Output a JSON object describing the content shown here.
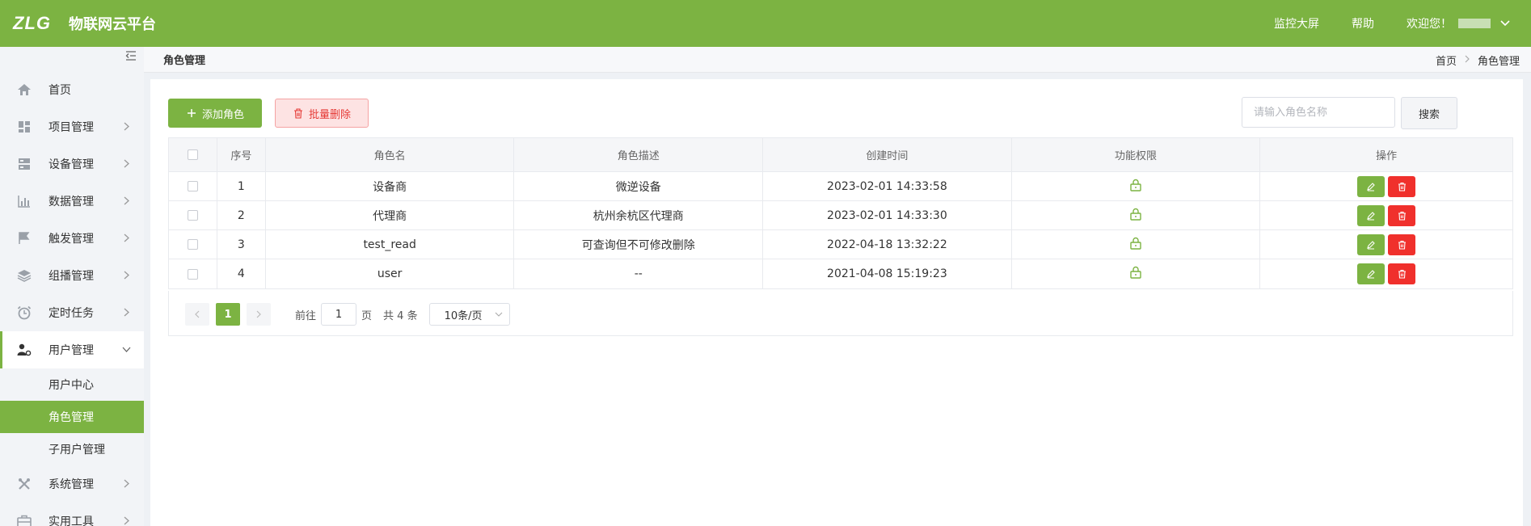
{
  "header": {
    "logo": "ZLG",
    "brand": "物联网云平台",
    "monitor_link": "监控大屏",
    "help_link": "帮助",
    "welcome": "欢迎您！",
    "bg_color": "#7cb342"
  },
  "breadcrumb": {
    "page_title": "角色管理",
    "home": "首页",
    "current": "角色管理"
  },
  "sidebar": {
    "items": [
      {
        "label": "首页",
        "icon": "home-icon",
        "has_arrow": false
      },
      {
        "label": "项目管理",
        "icon": "dashboard-icon",
        "has_arrow": true
      },
      {
        "label": "设备管理",
        "icon": "device-icon",
        "has_arrow": true
      },
      {
        "label": "数据管理",
        "icon": "bar-chart-icon",
        "has_arrow": true
      },
      {
        "label": "触发管理",
        "icon": "flag-icon",
        "has_arrow": true
      },
      {
        "label": "组播管理",
        "icon": "layers-icon",
        "has_arrow": true
      },
      {
        "label": "定时任务",
        "icon": "alarm-clock-icon",
        "has_arrow": true
      },
      {
        "label": "用户管理",
        "icon": "user-settings-icon",
        "has_arrow": true,
        "open": true
      },
      {
        "label": "系统管理",
        "icon": "tools-icon",
        "has_arrow": true
      },
      {
        "label": "实用工具",
        "icon": "toolbox-icon",
        "has_arrow": true
      }
    ],
    "sub_items": [
      {
        "label": "用户中心",
        "active": false
      },
      {
        "label": "角色管理",
        "active": true
      },
      {
        "label": "子用户管理",
        "active": false
      }
    ]
  },
  "toolbar": {
    "add_label": "添加角色",
    "batch_delete_label": "批量删除",
    "search_placeholder": "请输入角色名称",
    "search_label": "搜索"
  },
  "table": {
    "columns": [
      "序号",
      "角色名",
      "角色描述",
      "创建时间",
      "功能权限",
      "操作"
    ],
    "rows": [
      {
        "index": "1",
        "name": "设备商",
        "desc": "微逆设备",
        "created": "2023-02-01 14:33:58"
      },
      {
        "index": "2",
        "name": "代理商",
        "desc": "杭州余杭区代理商",
        "created": "2023-02-01 14:33:30"
      },
      {
        "index": "3",
        "name": "test_read",
        "desc": "可查询但不可修改删除",
        "created": "2022-04-18 13:32:22"
      },
      {
        "index": "4",
        "name": "user",
        "desc": "--",
        "created": "2021-04-08 15:19:23"
      }
    ]
  },
  "pagination": {
    "current_page": "1",
    "goto_prefix": "前往",
    "goto_value": "1",
    "goto_suffix": "页",
    "total": "共 4 条",
    "page_size": "10条/页"
  },
  "colors": {
    "accent": "#7cb342",
    "danger": "#f0302c"
  }
}
